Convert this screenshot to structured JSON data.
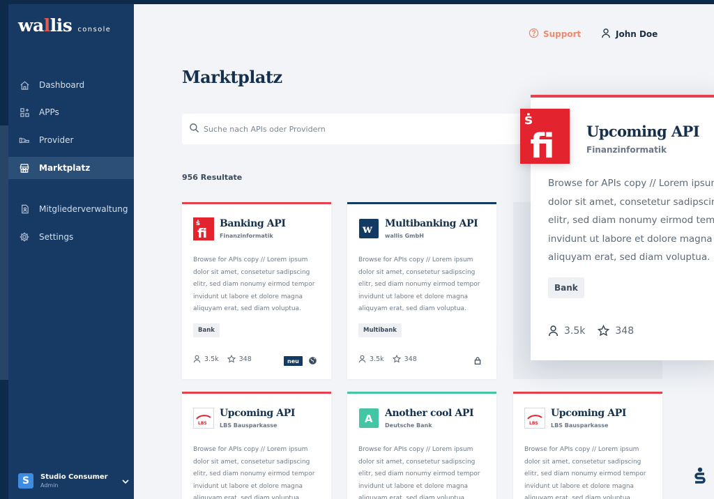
{
  "brand": {
    "name_part1": "wa",
    "name_dot": "l",
    "name_part2": "lis",
    "suffix": "console"
  },
  "sidebar": {
    "items": [
      {
        "label": "Dashboard",
        "icon": "home-icon"
      },
      {
        "label": "APPs",
        "icon": "apps-grid-icon"
      },
      {
        "label": "Provider",
        "icon": "provider-icon"
      },
      {
        "label": "Marktplatz",
        "icon": "store-icon",
        "active": true
      },
      {
        "label": "Mitgliederverwaltung",
        "icon": "members-icon"
      },
      {
        "label": "Settings",
        "icon": "gear-icon"
      }
    ],
    "account": {
      "initial": "S",
      "name": "Studio Consumer",
      "role": "Admin"
    }
  },
  "topbar": {
    "support_label": "Support",
    "user_name": "John Doe"
  },
  "main": {
    "title": "Marktplatz",
    "search_placeholder": "Suche nach APIs oder Providern",
    "results_label": "956 Resultate"
  },
  "cards": [
    {
      "title": "Banking API",
      "provider": "Finanzinformatik",
      "description": "Browse for APIs copy // Lorem ipsum dolor sit amet, consetetur sadipscing elitr, sed diam nonumy eirmod tempor invidunt ut labore et dolore magna aliquyam erat, sed diam voluptua.",
      "tag": "Bank",
      "users": "3.5k",
      "stars": "348",
      "badge": "neu",
      "accent": "#e3434f"
    },
    {
      "title": "Multibanking API",
      "provider": "wallis GmbH",
      "description": "Browse for APIs copy // Lorem ipsum dolor sit amet, consetetur sadipscing elitr, sed diam nonumy eirmod tempor invidunt ut labore et dolore magna aliquyam erat, sed diam voluptua.",
      "tag": "Multibank",
      "users": "3.5k",
      "stars": "348",
      "accent": "#123a63"
    },
    {
      "title": "Upcoming API",
      "provider": "LBS Bausparkasse",
      "description": "Browse for APIs copy // Lorem ipsum dolor sit amet, consetetur sadipscing elitr, sed diam nonumy eirmod tempor invidunt ut labore et dolore magna aliquyam erat, sed diam voluptua.",
      "accent": "#e3434f"
    },
    {
      "title": "Another cool API",
      "provider": "Deutsche Bank",
      "logo_letter": "A",
      "description": "Browse for APIs copy // Lorem ipsum dolor sit amet, consetetur sadipscing elitr, sed diam nonumy eirmod tempor invidunt ut labore et dolore magna aliquyam erat, sed diam voluptua.",
      "accent": "#44c6a4"
    },
    {
      "title": "Upcoming API",
      "provider": "LBS Bausparkasse",
      "description": "Browse for APIs copy // Lorem ipsum dolor sit amet, consetetur sadipscing elitr, sed diam nonumy eirmod tempor invidunt ut labore et dolore magna aliquyam erat, sed diam voluptua.",
      "accent": "#e3434f"
    }
  ],
  "overlay": {
    "title": "Upcoming API",
    "provider": "Finanzinformatik",
    "desc_lines": [
      "Browse for APIs copy // Lorem ipsum",
      "dolor sit amet, consetetur sadipscing",
      "elitr, sed diam nonumy eirmod tempor",
      "invidunt ut labore et dolore magna",
      "aliquyam erat, sed diam voluptua."
    ],
    "tag": "Bank",
    "users": "3.5k",
    "stars": "348"
  },
  "colors": {
    "sidebar_bg": "#163a63",
    "accent_red": "#e3434f",
    "support_orange": "#ef8a6b",
    "teal": "#44c6a4"
  }
}
